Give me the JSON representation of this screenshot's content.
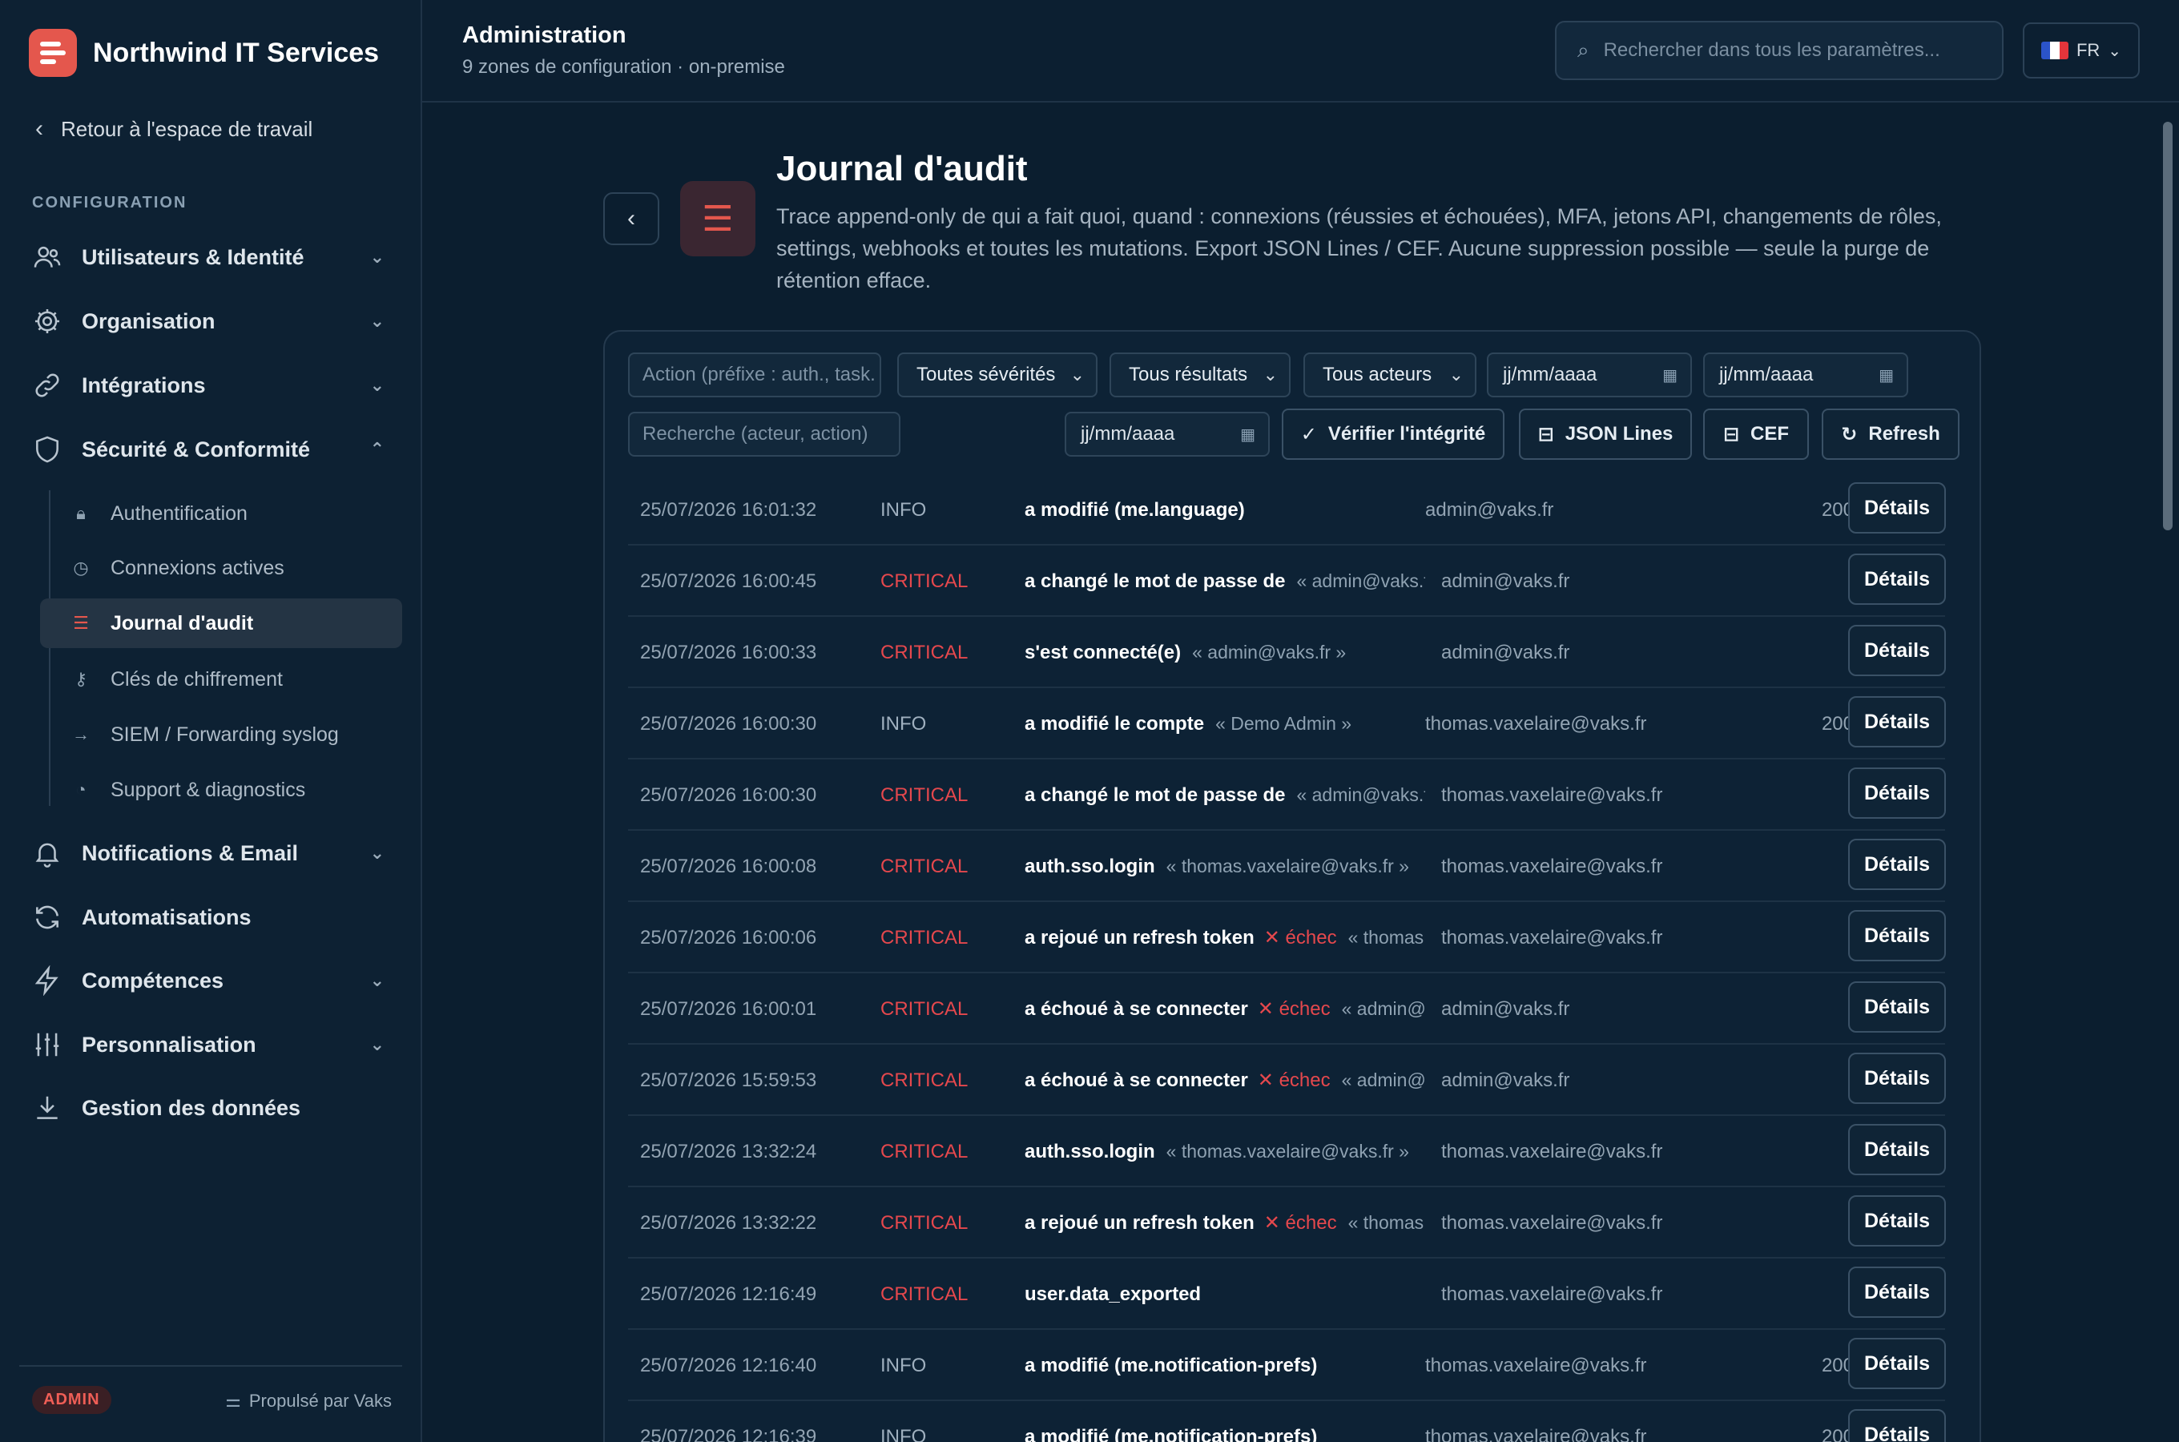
{
  "app": {
    "name": "Northwind IT Services",
    "back_label": "Retour à l'espace de travail",
    "section_label": "CONFIGURATION",
    "admin_badge": "ADMIN",
    "powered_by": "Propulsé par Vaks"
  },
  "nav": {
    "users": "Utilisateurs & Identité",
    "org": "Organisation",
    "integrations": "Intégrations",
    "security": "Sécurité & Conformité",
    "notifications": "Notifications & Email",
    "automations": "Automatisations",
    "skills": "Compétences",
    "personalization": "Personnalisation",
    "data": "Gestion des données"
  },
  "subnav": {
    "auth": "Authentification",
    "sessions": "Connexions actives",
    "audit": "Journal d'audit",
    "keys": "Clés de chiffrement",
    "siem": "SIEM / Forwarding syslog",
    "support": "Support & diagnostics"
  },
  "header": {
    "title": "Administration",
    "subtitle": "9 zones de configuration · on-premise",
    "search_placeholder": "Rechercher dans tous les paramètres...",
    "lang": "FR"
  },
  "page": {
    "title": "Journal d'audit",
    "description": "Trace append-only de qui a fait quoi, quand : connexions (réussies et échouées), MFA, jetons API, changements de rôles, settings, webhooks et toutes les mutations. Export JSON Lines / CEF. Aucune suppression possible — seule la purge de rétention efface."
  },
  "filters": {
    "action_placeholder": "Action (préfixe : auth., task.",
    "severity": "Toutes sévérités",
    "result": "Tous résultats",
    "actor": "Tous acteurs",
    "date_placeholder": "jj/mm/aaaa",
    "search_placeholder": "Recherche (acteur, action)",
    "verify": "Vérifier l'intégrité",
    "jsonl": "JSON Lines",
    "cef": "CEF",
    "refresh": "Refresh"
  },
  "colors": {
    "accent": "#e4574d",
    "critical": "#e5484d",
    "background": "#0b1e2f",
    "sidebar": "#0d2133"
  },
  "rows_details_label": "Détails",
  "rows": [
    {
      "ts": "25/07/2026 16:01:32",
      "sev": "INFO",
      "action": "a modifié (me.language)",
      "fail": "",
      "target": "",
      "actor": "admin@vaks.fr",
      "code": "200"
    },
    {
      "ts": "25/07/2026 16:00:45",
      "sev": "CRITICAL",
      "action": "a changé le mot de passe de",
      "fail": "",
      "target": "« admin@vaks.f",
      "actor": "admin@vaks.fr",
      "code": ""
    },
    {
      "ts": "25/07/2026 16:00:33",
      "sev": "CRITICAL",
      "action": "s'est connecté(e)",
      "fail": "",
      "target": "« admin@vaks.fr »",
      "actor": "admin@vaks.fr",
      "code": ""
    },
    {
      "ts": "25/07/2026 16:00:30",
      "sev": "INFO",
      "action": "a modifié le compte",
      "fail": "",
      "target": "« Demo Admin »",
      "actor": "thomas.vaxelaire@vaks.fr",
      "code": "200"
    },
    {
      "ts": "25/07/2026 16:00:30",
      "sev": "CRITICAL",
      "action": "a changé le mot de passe de",
      "fail": "",
      "target": "« admin@vaks.f",
      "actor": "thomas.vaxelaire@vaks.fr",
      "code": ""
    },
    {
      "ts": "25/07/2026 16:00:08",
      "sev": "CRITICAL",
      "action": "auth.sso.login",
      "fail": "",
      "target": "« thomas.vaxelaire@vaks.fr »",
      "actor": "thomas.vaxelaire@vaks.fr",
      "code": ""
    },
    {
      "ts": "25/07/2026 16:00:06",
      "sev": "CRITICAL",
      "action": "a rejoué un refresh token",
      "fail": "✕ échec",
      "target": "« thomas",
      "actor": "thomas.vaxelaire@vaks.fr",
      "code": ""
    },
    {
      "ts": "25/07/2026 16:00:01",
      "sev": "CRITICAL",
      "action": "a échoué à se connecter",
      "fail": "✕ échec",
      "target": "« admin@",
      "actor": "admin@vaks.fr",
      "code": ""
    },
    {
      "ts": "25/07/2026 15:59:53",
      "sev": "CRITICAL",
      "action": "a échoué à se connecter",
      "fail": "✕ échec",
      "target": "« admin@",
      "actor": "admin@vaks.fr",
      "code": ""
    },
    {
      "ts": "25/07/2026 13:32:24",
      "sev": "CRITICAL",
      "action": "auth.sso.login",
      "fail": "",
      "target": "« thomas.vaxelaire@vaks.fr »",
      "actor": "thomas.vaxelaire@vaks.fr",
      "code": ""
    },
    {
      "ts": "25/07/2026 13:32:22",
      "sev": "CRITICAL",
      "action": "a rejoué un refresh token",
      "fail": "✕ échec",
      "target": "« thomas",
      "actor": "thomas.vaxelaire@vaks.fr",
      "code": ""
    },
    {
      "ts": "25/07/2026 12:16:49",
      "sev": "CRITICAL",
      "action": "user.data_exported",
      "fail": "",
      "target": "",
      "actor": "thomas.vaxelaire@vaks.fr",
      "code": ""
    },
    {
      "ts": "25/07/2026 12:16:40",
      "sev": "INFO",
      "action": "a modifié (me.notification-prefs)",
      "fail": "",
      "target": "",
      "actor": "thomas.vaxelaire@vaks.fr",
      "code": "200"
    },
    {
      "ts": "25/07/2026 12:16:39",
      "sev": "INFO",
      "action": "a modifié (me.notification-prefs)",
      "fail": "",
      "target": "",
      "actor": "thomas.vaxelaire@vaks.fr",
      "code": "200"
    }
  ]
}
